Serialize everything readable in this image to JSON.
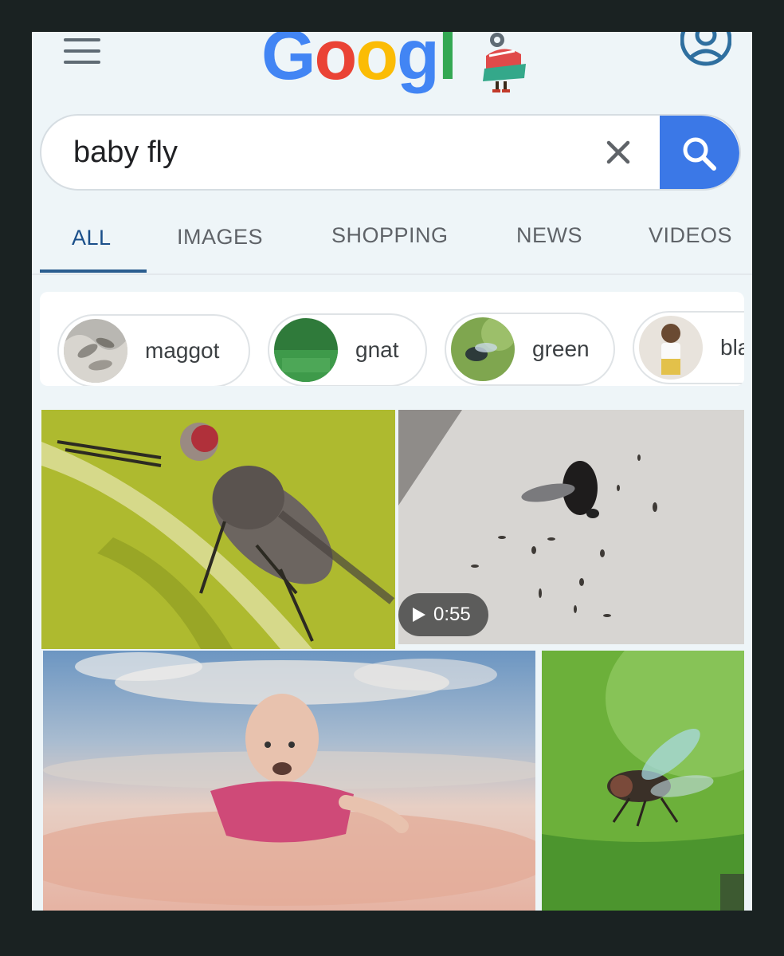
{
  "header": {
    "logo_text": [
      "G",
      "o",
      "o",
      "g",
      "l"
    ],
    "menu_icon": "hamburger-menu-icon",
    "account_icon": "account-circle-icon"
  },
  "search": {
    "query": "baby fly",
    "clear_icon": "close-icon",
    "button_icon": "search-icon",
    "accent_color": "#3b78e7"
  },
  "tabs": [
    {
      "label": "ALL",
      "active": true
    },
    {
      "label": "IMAGES",
      "active": false
    },
    {
      "label": "SHOPPING",
      "active": false
    },
    {
      "label": "NEWS",
      "active": false
    },
    {
      "label": "VIDEOS",
      "active": false
    }
  ],
  "chips": [
    {
      "label": "maggot"
    },
    {
      "label": "gnat"
    },
    {
      "label": "green"
    },
    {
      "label": "bla"
    }
  ],
  "results": [
    {
      "type": "image",
      "subject": "fly on grass stem"
    },
    {
      "type": "video",
      "subject": "fly with maggots on white surface",
      "duration": "0:55"
    },
    {
      "type": "image",
      "subject": "baby flying in sky"
    },
    {
      "type": "image",
      "subject": "fly on green leaf"
    }
  ]
}
